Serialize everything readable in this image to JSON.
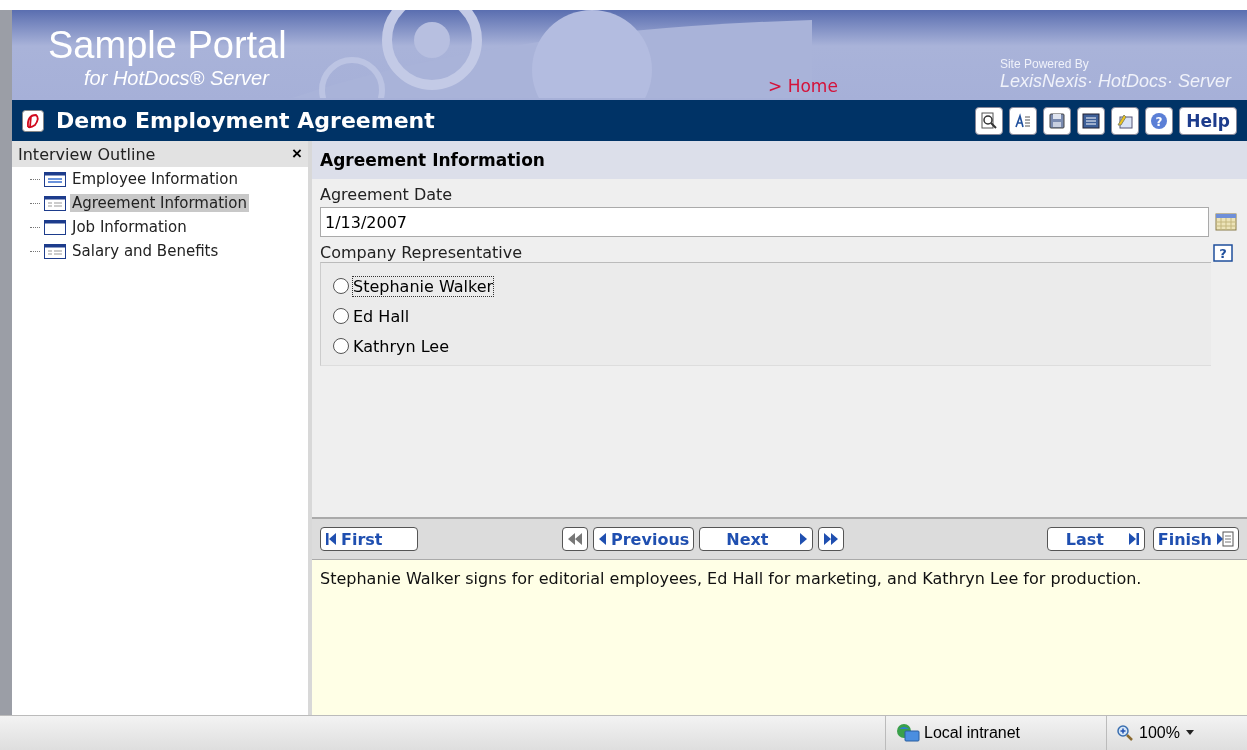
{
  "banner": {
    "title": "Sample Portal",
    "subtitle": "for HotDocs® Server",
    "home_link": "> Home",
    "powered_by": "Site Powered By",
    "powered_brand": "LexisNexis· HotDocs· Server"
  },
  "titlebar": {
    "title": "Demo Employment Agreement",
    "tools": [
      {
        "kind": "preview"
      },
      {
        "kind": "format"
      },
      {
        "kind": "save"
      },
      {
        "kind": "list"
      },
      {
        "kind": "edit"
      },
      {
        "kind": "help",
        "glyph": "?"
      }
    ],
    "help_button": "Help"
  },
  "outline": {
    "title": "Interview Outline",
    "close": "×",
    "items": [
      {
        "label": "Employee Information",
        "selected": false,
        "kind": "lines"
      },
      {
        "label": "Agreement Information",
        "selected": true,
        "kind": "grid"
      },
      {
        "label": "Job Information",
        "selected": false,
        "kind": "blank"
      },
      {
        "label": "Salary and Benefits",
        "selected": false,
        "kind": "grid"
      }
    ]
  },
  "dialog": {
    "title": "Agreement Information",
    "fields": [
      {
        "label": "Agreement Date",
        "value": "1/13/2007"
      }
    ],
    "group": {
      "label": "Company Representative",
      "help_glyph": "?",
      "options": [
        {
          "label": "Stephanie Walker",
          "selected": false,
          "focused": true
        },
        {
          "label": "Ed Hall",
          "selected": false,
          "focused": false
        },
        {
          "label": "Kathryn Lee",
          "selected": false,
          "focused": false
        }
      ]
    }
  },
  "nav": [
    {
      "kind": "first",
      "label": "First"
    },
    {
      "kind": "rewind"
    },
    {
      "kind": "previous",
      "label": "Previous"
    },
    {
      "kind": "next",
      "label": "Next"
    },
    {
      "kind": "forward"
    },
    {
      "kind": "last",
      "label": "Last"
    },
    {
      "kind": "finish",
      "label": "Finish"
    }
  ],
  "help_text": "Stephanie Walker signs for editorial employees, Ed Hall for marketing, and Kathryn Lee for production.",
  "status_bar": {
    "zone": "Local intranet",
    "zoom": "100%"
  }
}
